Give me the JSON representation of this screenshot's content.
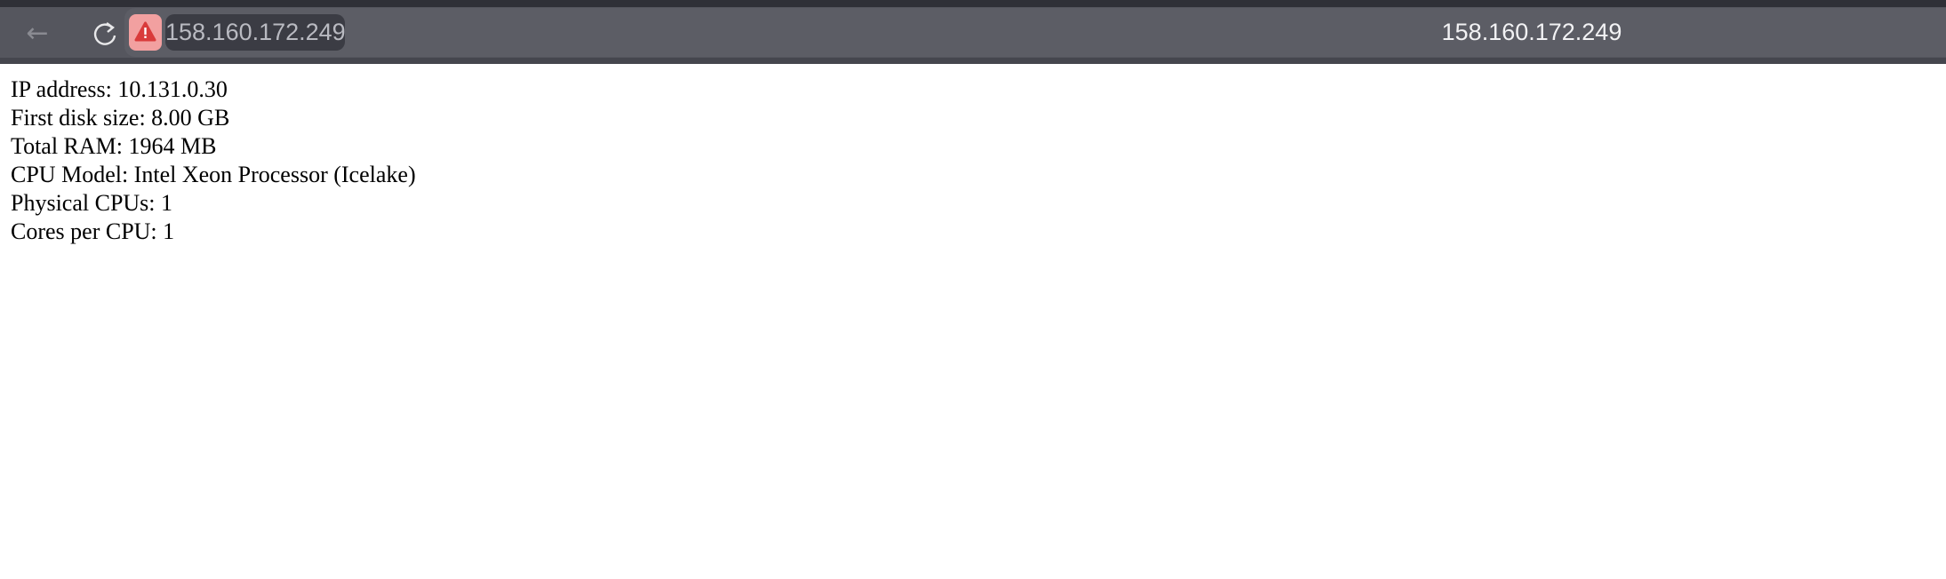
{
  "browser": {
    "url": "158.160.172.249",
    "tab_title": "158.160.172.249",
    "security_icon": "warning-triangle-icon",
    "warning_color": "#f2a0a0"
  },
  "content": {
    "lines": [
      "IP address: 10.131.0.30",
      "First disk size: 8.00 GB",
      "Total RAM: 1964 MB",
      "CPU Model: Intel Xeon Processor (Icelake)",
      "Physical CPUs: 1",
      "Cores per CPU: 1"
    ]
  }
}
